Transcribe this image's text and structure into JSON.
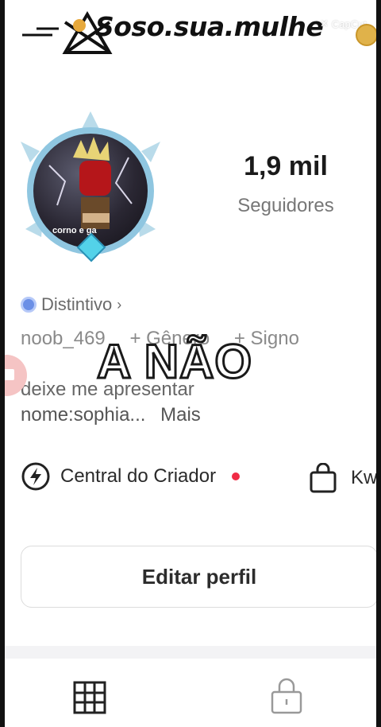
{
  "watermark": {
    "text": "Soso.sua.mulhe",
    "capcut": "CapCut"
  },
  "profile": {
    "avatar_caption": "corno e ga",
    "followers_count": "1,9 mil",
    "followers_label": "Seguidores",
    "badge_label": "Distintivo",
    "tags": [
      "noob_469",
      "+ Gênero",
      "+ Signo"
    ],
    "bio_line1": "deixe me apresentar",
    "bio_line2": "nome:sophia...",
    "more_label": "Mais"
  },
  "overlay_text": "A NÃO",
  "creator": {
    "label": "Central do Criador",
    "shop_label": "Kw"
  },
  "edit_label": "Editar perfil",
  "icons": [
    "lightning-icon",
    "bag-icon",
    "grid-icon",
    "lock-icon",
    "hexagon-badge-icon",
    "video-icon"
  ],
  "colors": {
    "notify_dot": "#f02b45",
    "badge": "#6b8fe6",
    "ring": "#8fc6e0"
  }
}
